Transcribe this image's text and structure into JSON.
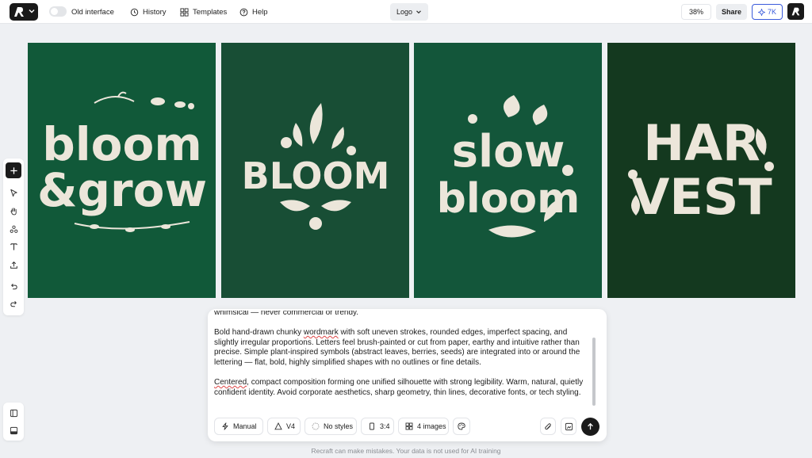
{
  "topbar": {
    "old_interface_label": "Old interface",
    "history_label": "History",
    "templates_label": "Templates",
    "help_label": "Help",
    "style_select_value": "Logo",
    "zoom_value": "38%",
    "share_label": "Share",
    "credits_label": "7K"
  },
  "canvas": {
    "images": [
      {
        "bg": "#115939",
        "lines": [
          "bloom",
          "&grow"
        ]
      },
      {
        "bg": "#184e35",
        "lines": [
          "BLOOM"
        ]
      },
      {
        "bg": "#13563a",
        "lines": [
          "slow",
          "bloom"
        ]
      },
      {
        "bg": "#14391f",
        "lines": [
          "HAR",
          "VEST"
        ]
      }
    ]
  },
  "prompt": {
    "paragraphs": [
      "whimsical — never commercial or trendy.",
      "Bold hand-drawn chunky wordmark with soft uneven strokes, rounded edges, imperfect spacing, and slightly irregular proportions. Letters feel brush-painted or cut from paper, earthy and intuitive rather than precise. Simple plant-inspired symbols (abstract leaves, berries, seeds) are integrated into or around the lettering — flat, bold, highly simplified shapes with no outlines or fine details.",
      "Centered, compact composition forming one unified silhouette with strong legibility. Warm, natural, quietly confident identity. Avoid corporate aesthetics, sharp geometry, thin lines, decorative fonts, or tech styling."
    ],
    "settings": {
      "mode": "Manual",
      "model": "V4",
      "styles": "No styles",
      "aspect_ratio": "3:4",
      "count": "4 images"
    }
  },
  "disclaimer": "Recraft can make mistakes. Your data is not used for AI training",
  "colors": {
    "accent": "#3b5bdb",
    "dark": "#1a1a1a",
    "letter": "#ece6da"
  }
}
